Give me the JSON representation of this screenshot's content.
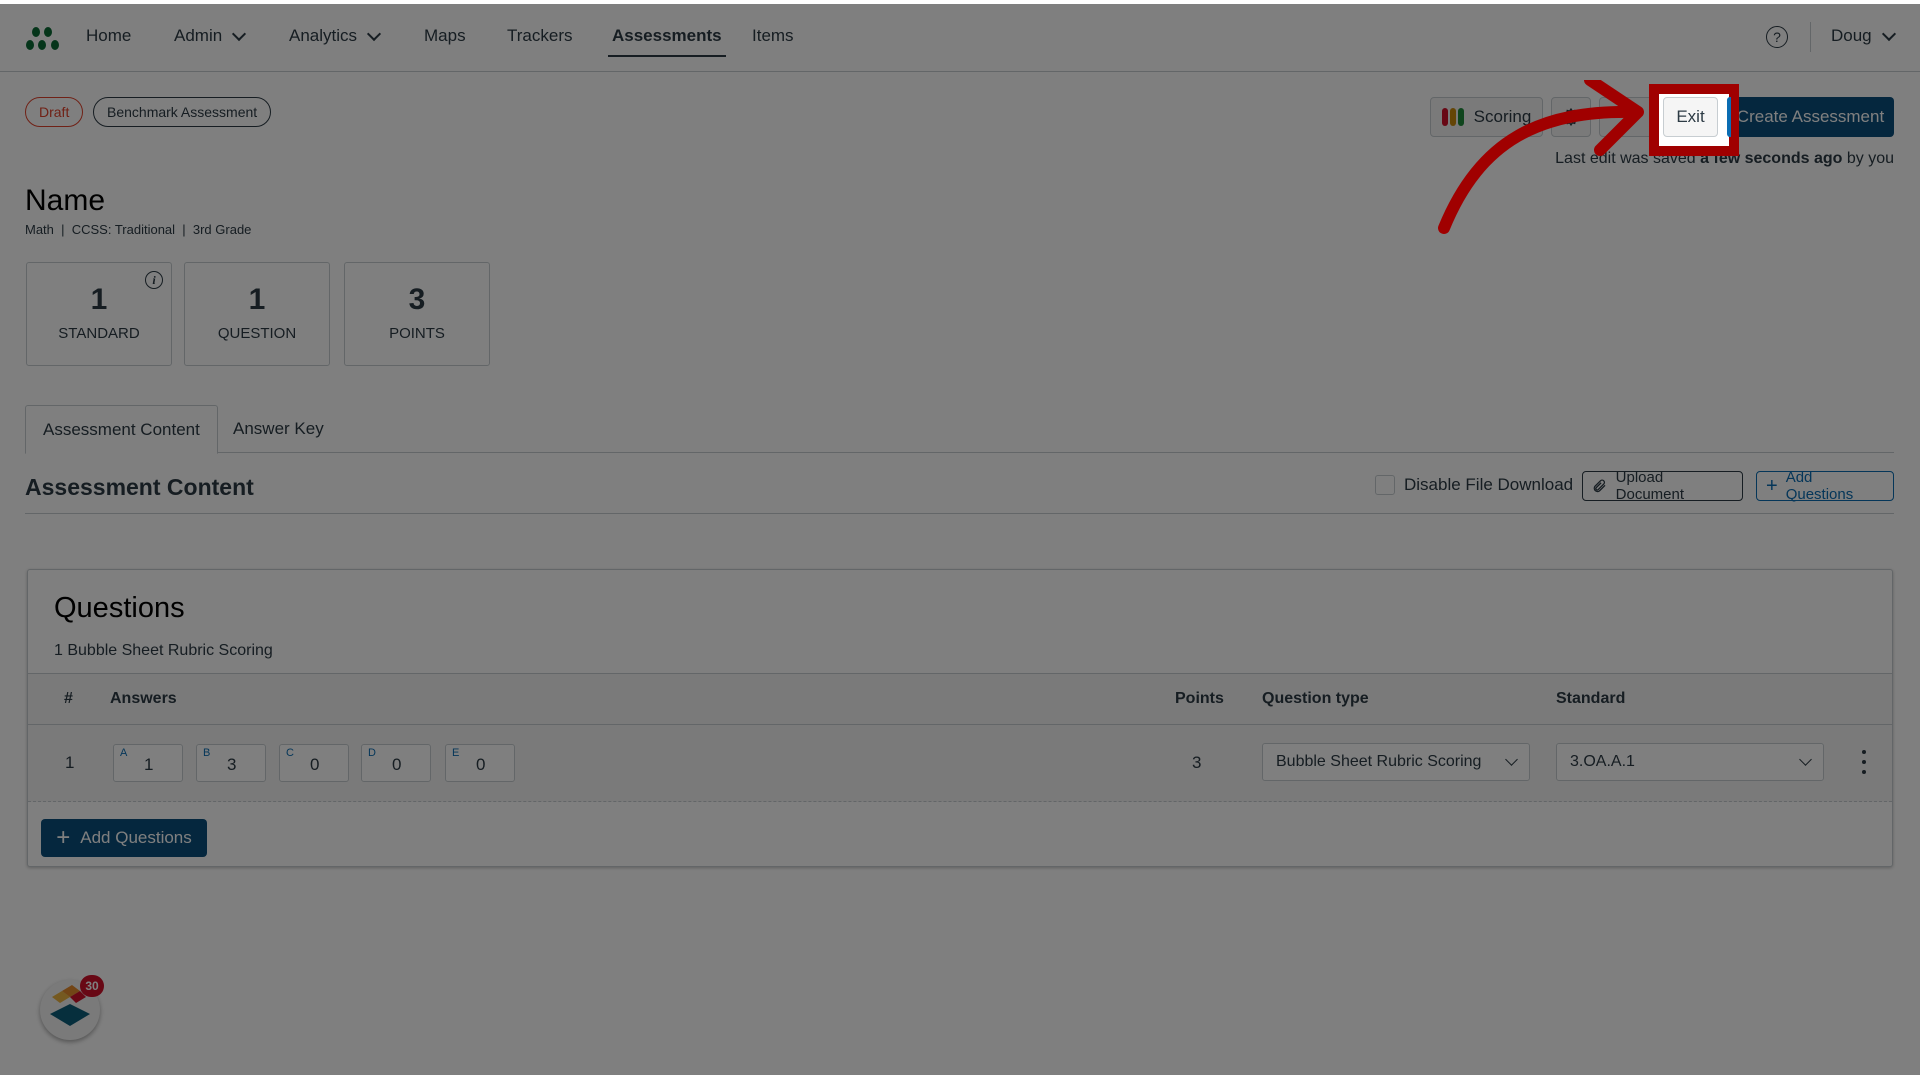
{
  "nav": {
    "logo": "app-logo",
    "items": [
      {
        "label": "Home",
        "dropdown": false,
        "active": false
      },
      {
        "label": "Admin",
        "dropdown": true,
        "active": false
      },
      {
        "label": "Analytics",
        "dropdown": true,
        "active": false
      },
      {
        "label": "Maps",
        "dropdown": false,
        "active": false
      },
      {
        "label": "Trackers",
        "dropdown": false,
        "active": false
      },
      {
        "label": "Assessments",
        "dropdown": false,
        "active": true
      },
      {
        "label": "Items",
        "dropdown": false,
        "active": false
      }
    ],
    "help_icon": "?",
    "user": "Doug"
  },
  "badges": {
    "status": "Draft",
    "type": "Benchmark Assessment"
  },
  "toolbar": {
    "scoring_label": "Scoring",
    "scoring_colors": [
      "#d0102a",
      "#c98a0c",
      "#1f8a3a"
    ],
    "settings_icon": "gear-icon",
    "more_icon": "kebab-icon",
    "exit_label": "Exit",
    "create_label": "Create Assessment",
    "last_edit_prefix": "Last edit was saved",
    "last_edit_time": "a few seconds ago",
    "last_edit_suffix": "by you"
  },
  "assessment": {
    "title": "Name",
    "meta": "Math  |  CCSS: Traditional  |  3rd Grade"
  },
  "stats": [
    {
      "value": "1",
      "label": "STANDARD",
      "info": true
    },
    {
      "value": "1",
      "label": "QUESTION",
      "info": false
    },
    {
      "value": "3",
      "label": "POINTS",
      "info": false
    }
  ],
  "tabs": [
    {
      "label": "Assessment Content",
      "active": true
    },
    {
      "label": "Answer Key",
      "active": false
    }
  ],
  "section": {
    "title": "Assessment Content",
    "disable_download_label": "Disable File Download",
    "disable_download_checked": false,
    "upload_label": "Upload Document",
    "add_questions_label": "Add Questions"
  },
  "questions": {
    "title": "Questions",
    "subtitle": "1 Bubble Sheet Rubric Scoring",
    "columns": [
      "#",
      "Answers",
      "Points",
      "Question type",
      "Standard"
    ],
    "rows": [
      {
        "number": "1",
        "answers": [
          {
            "letter": "A",
            "value": "1"
          },
          {
            "letter": "B",
            "value": "3"
          },
          {
            "letter": "C",
            "value": "0"
          },
          {
            "letter": "D",
            "value": "0"
          },
          {
            "letter": "E",
            "value": "0"
          }
        ],
        "points": "3",
        "question_type": "Bubble Sheet Rubric Scoring",
        "standard": "3.OA.A.1"
      }
    ],
    "add_button_label": "Add Questions"
  },
  "widget": {
    "notification_count": "30"
  },
  "annotation": {
    "highlight_target": "Exit",
    "highlight_color": "#a00000"
  }
}
